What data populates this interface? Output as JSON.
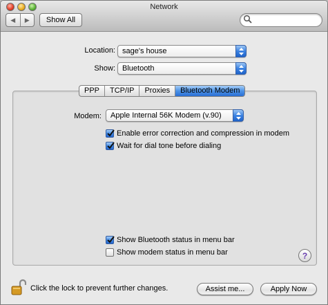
{
  "window": {
    "title": "Network"
  },
  "toolbar": {
    "back": "◀",
    "forward": "▶",
    "show_all": "Show All",
    "search_placeholder": ""
  },
  "location": {
    "label": "Location:",
    "value": "sage's house"
  },
  "show": {
    "label": "Show:",
    "value": "Bluetooth"
  },
  "tabs": [
    {
      "label": "PPP",
      "active": false
    },
    {
      "label": "TCP/IP",
      "active": false
    },
    {
      "label": "Proxies",
      "active": false
    },
    {
      "label": "Bluetooth Modem",
      "active": true
    }
  ],
  "modem": {
    "label": "Modem:",
    "value": "Apple Internal 56K Modem (v.90)"
  },
  "options": [
    {
      "label": "Enable error correction and compression in modem",
      "checked": true
    },
    {
      "label": "Wait for dial tone before dialing",
      "checked": true
    },
    {
      "label": "Show Bluetooth status in menu bar",
      "checked": true
    },
    {
      "label": "Show modem status in menu bar",
      "checked": false
    }
  ],
  "help": {
    "label": "?"
  },
  "footer": {
    "lock_text": "Click the lock to prevent further changes.",
    "assist": "Assist me...",
    "apply": "Apply Now"
  },
  "icons": [
    "close-light",
    "minimize-light",
    "zoom-light",
    "search-icon",
    "lock-icon",
    "help-icon",
    "popup-arrows-icon",
    "checkmark-icon"
  ]
}
